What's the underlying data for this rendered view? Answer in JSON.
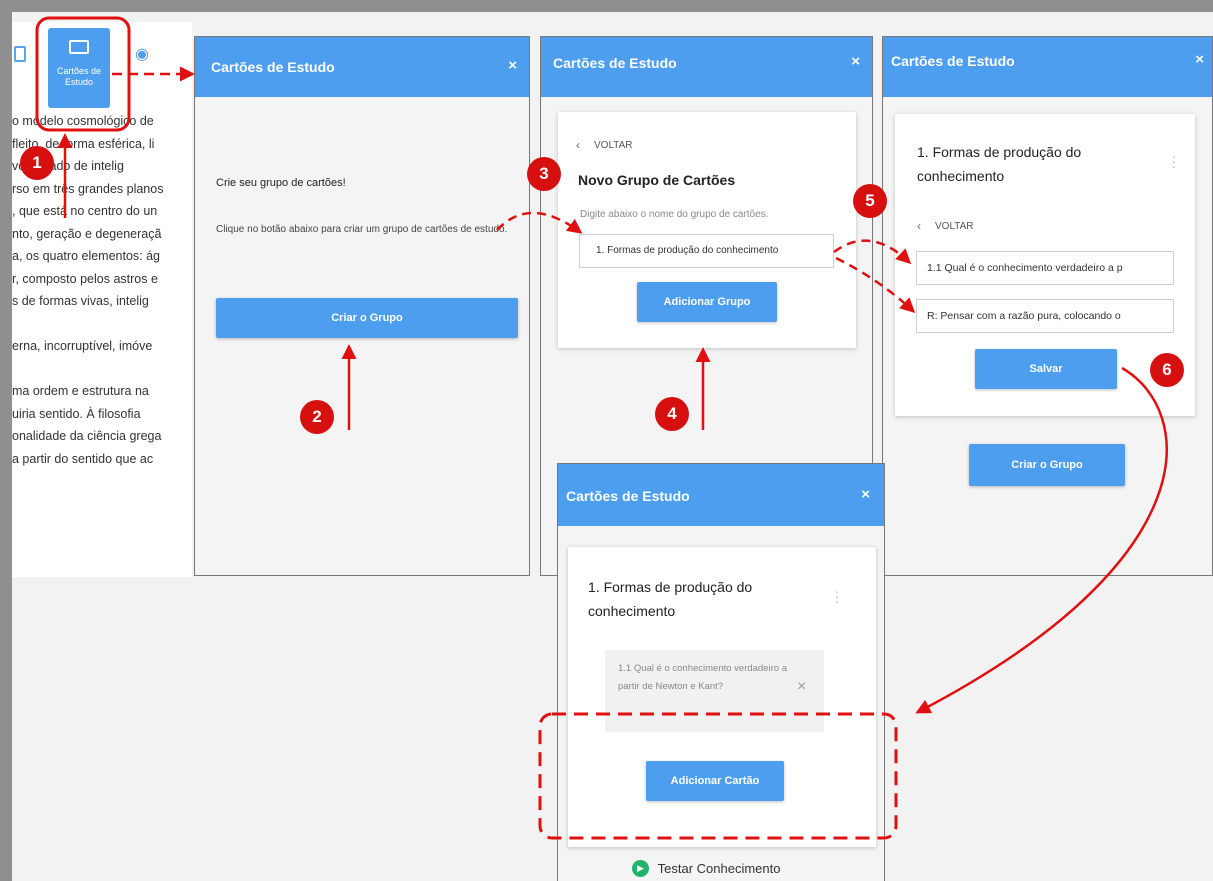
{
  "reader": {
    "toolbar_button_label": "Cartões de Estudo",
    "lines": [
      "o modelo cosmológico de",
      "fleito, de forma esférica, li",
      "vo, dotado de intelig",
      "rso em três grandes planos",
      ", que está no centro do un",
      "nto, geração e degeneraçã",
      "a, os quatro elementos: ág",
      "r, composto pelos astros e",
      "s de formas vivas, intelig",
      "",
      "erna, incorruptível, imóve",
      "",
      "ma ordem e estrutura na",
      "uiria sentido. À filosofia",
      "onalidade da ciência grega",
      "a partir do sentido que ac"
    ]
  },
  "panel1": {
    "title": "Cartões de Estudo",
    "close": "×",
    "heading": "Crie seu grupo de cartões!",
    "body": "Clique no botão abaixo para criar um grupo de cartões de estudo.",
    "button": "Criar o Grupo"
  },
  "panel2": {
    "title": "Cartões de Estudo",
    "close": "×",
    "back": "VOLTAR",
    "heading": "Novo Grupo de Cartões",
    "hint": "Digite abaixo o nome do grupo de cartões.",
    "input_value": "1. Formas de produção do conhecimento",
    "button": "Adicionar Grupo"
  },
  "panel3": {
    "title": "Cartões de Estudo",
    "close": "×",
    "group_title": "1. Formas de produção do conhecimento",
    "back": "VOLTAR",
    "question_value": "1.1 Qual é o conhecimento verdadeiro a p",
    "answer_value": "R: Pensar com a razão pura, colocando o",
    "save_button": "Salvar",
    "create_button": "Criar o Grupo"
  },
  "panel4": {
    "title": "Cartões de Estudo",
    "close": "×",
    "group_title": "1. Formas de produção do conhecimento",
    "card_text": "1.1 Qual é o conhecimento verdadeiro a partir de Newton e Kant?",
    "card_remove": "×",
    "add_button": "Adicionar Cartão",
    "test_link": "Testar Conhecimento"
  },
  "steps": [
    "1",
    "2",
    "3",
    "4",
    "5",
    "6"
  ],
  "colors": {
    "accent": "#4d9eee",
    "annotation": "#e01010",
    "frame": "#8f8f8f"
  },
  "icons": [
    "flashcards-icon",
    "eye-icon",
    "chevron-left-icon",
    "kebab-menu-icon",
    "close-icon",
    "play-circle-icon"
  ]
}
